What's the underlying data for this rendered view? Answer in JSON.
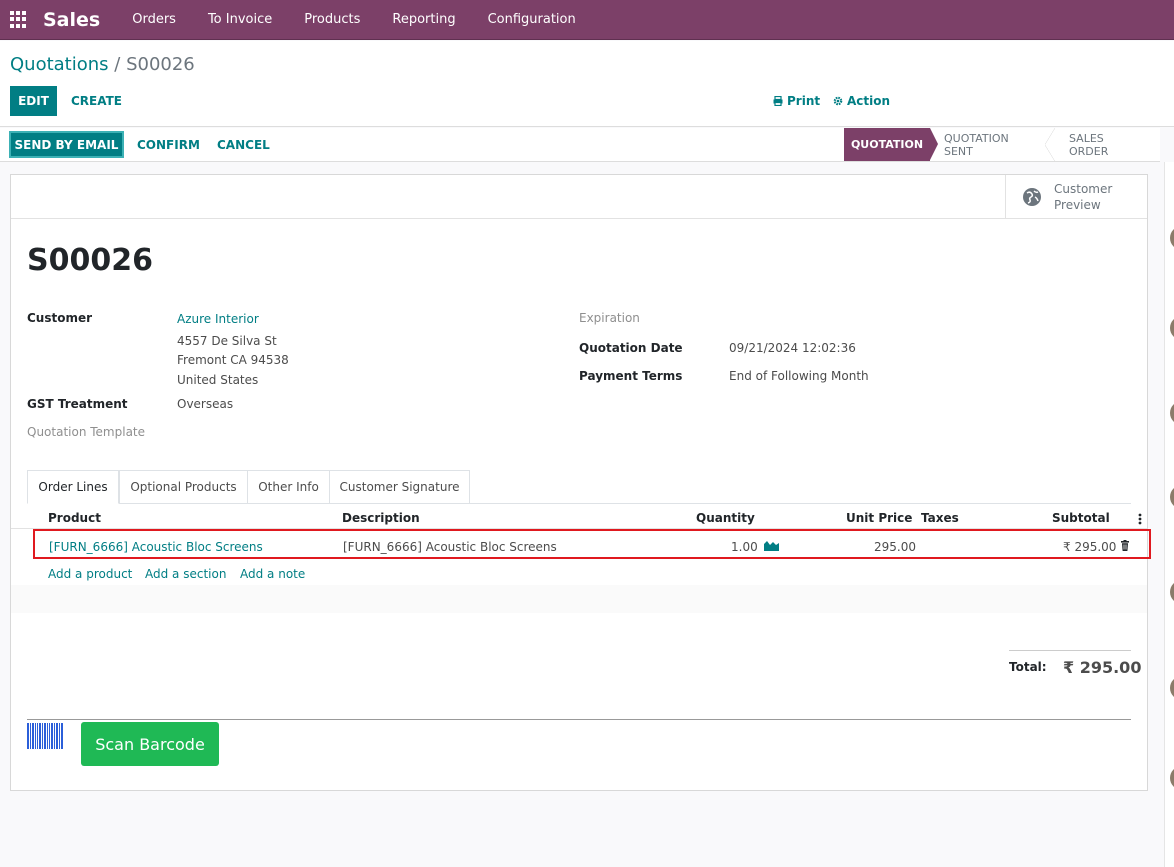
{
  "navbar": {
    "app_title": "Sales",
    "menu": [
      "Orders",
      "To Invoice",
      "Products",
      "Reporting",
      "Configuration"
    ]
  },
  "breadcrumb": {
    "parent": "Quotations",
    "separator": " / ",
    "current": "S00026"
  },
  "control": {
    "edit_label": "EDIT",
    "create_label": "CREATE",
    "print_label": "Print",
    "action_label": "Action"
  },
  "statusbar": {
    "send_email_label": "SEND BY EMAIL",
    "confirm_label": "CONFIRM",
    "cancel_label": "CANCEL",
    "stages": [
      "QUOTATION",
      "QUOTATION SENT",
      "SALES ORDER"
    ],
    "active_stage": "QUOTATION"
  },
  "sheet": {
    "customer_preview_label": "Customer Preview",
    "title": "S00026",
    "fields": {
      "customer_label": "Customer",
      "customer_name": "Azure Interior",
      "address_line1": "4557 De Silva St",
      "address_line2": "Fremont CA 94538",
      "address_line3": "United States",
      "gst_label": "GST Treatment",
      "gst_value": "Overseas",
      "template_label": "Quotation Template",
      "expiration_label": "Expiration",
      "quotation_date_label": "Quotation Date",
      "quotation_date_value": "09/21/2024 12:02:36",
      "payment_terms_label": "Payment Terms",
      "payment_terms_value": "End of Following Month"
    },
    "tabs": [
      "Order Lines",
      "Optional Products",
      "Other Info",
      "Customer Signature"
    ],
    "table": {
      "headers": [
        "Product",
        "Description",
        "Quantity",
        "Unit Price",
        "Taxes",
        "Subtotal"
      ],
      "rows": [
        {
          "product": "[FURN_6666] Acoustic Bloc Screens",
          "description": "[FURN_6666] Acoustic Bloc Screens",
          "quantity": "1.00",
          "unit_price": "295.00",
          "taxes": "",
          "subtotal": "₹ 295.00"
        }
      ],
      "add_links": [
        "Add a product",
        "Add a section",
        "Add a note"
      ]
    },
    "total_label": "Total:",
    "total_value": "₹ 295.00",
    "scan_barcode_label": "Scan Barcode"
  },
  "colors": {
    "brand": "#7c4068",
    "primary": "#017e84",
    "scan_button": "#1fb955",
    "highlight_border": "#e0191f"
  }
}
